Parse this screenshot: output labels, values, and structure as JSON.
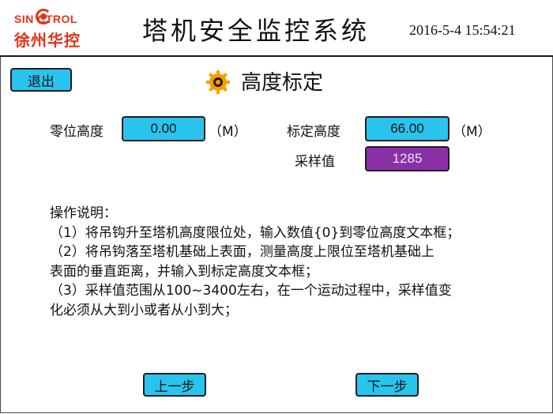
{
  "header": {
    "logo_en": "SIN   CTROL",
    "logo_cn": "徐州华控",
    "title": "塔机安全监控系统",
    "datetime": "2016-5-4  15:54:21"
  },
  "toolbar": {
    "exit_label": "退出"
  },
  "page": {
    "title": "高度标定",
    "icon": "gear-icon"
  },
  "form": {
    "zero_height": {
      "label": "零位高度",
      "value": "0.00",
      "unit": "（M）"
    },
    "calib_height": {
      "label": "标定高度",
      "value": "66.00",
      "unit": "（M）"
    },
    "sample": {
      "label": "采样值",
      "value": "1285"
    }
  },
  "instructions": {
    "heading": "操作说明：",
    "lines": [
      "（1）将吊钩升至塔机高度限位处，输入数值{0}到零位高度文本框；",
      "（2）将吊钩落至塔机基础上表面，测量高度上限位至塔机基础上",
      "表面的垂直距离，并输入到标定高度文本框；",
      "（3）采样值范围从100~3400左右，在一个运动过程中，采样值变",
      "化必须从大到小或者从小到大；"
    ]
  },
  "nav": {
    "prev_label": "上一步",
    "next_label": "下一步"
  },
  "colors": {
    "field_blue": "#29c4ee",
    "field_purple": "#8a2fa8",
    "logo_red": "#e0341a",
    "gear_orange": "#f5a000"
  }
}
